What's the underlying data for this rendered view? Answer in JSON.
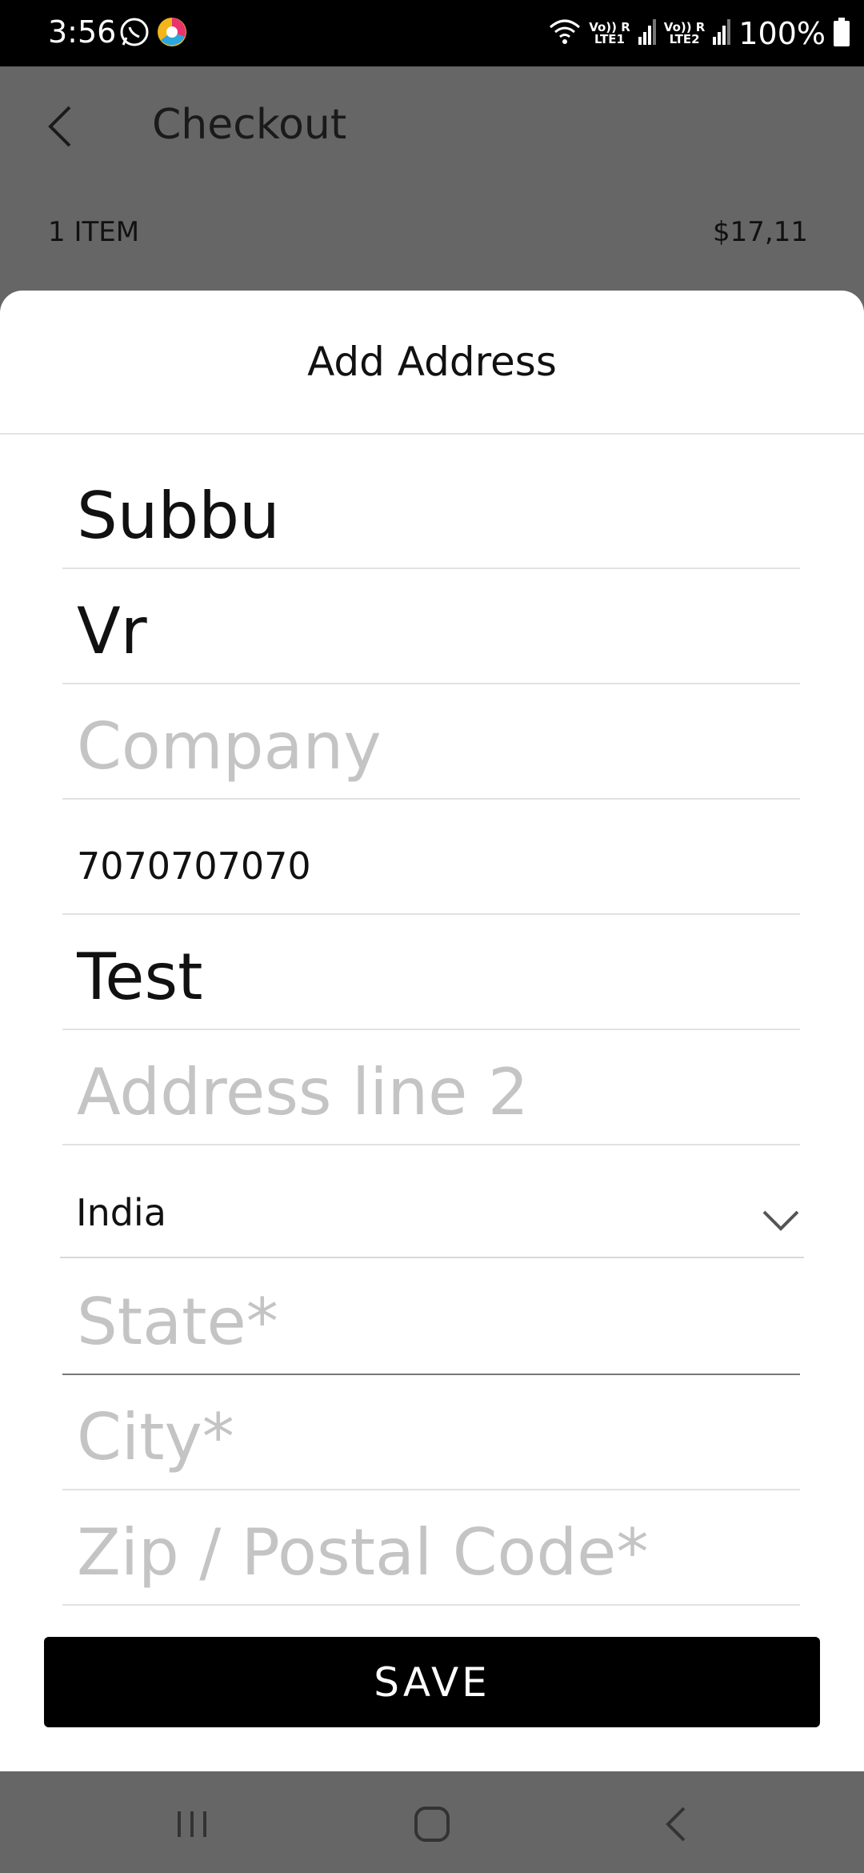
{
  "status_bar": {
    "time": "3:56",
    "lte1": "Vo)) R\nLTE1",
    "lte2": "Vo)) R\nLTE2",
    "battery": "100%",
    "icons": [
      "whatsapp-icon",
      "chrome-like-app-icon",
      "wifi-icon",
      "signal-icon",
      "battery-icon"
    ]
  },
  "header": {
    "title": "Checkout"
  },
  "summary": {
    "item_count": "1 ITEM",
    "total": "$17,11"
  },
  "sheet": {
    "title": "Add Address",
    "fields": {
      "first_name": {
        "value": "Subbu",
        "placeholder": ""
      },
      "last_name": {
        "value": "Vr",
        "placeholder": ""
      },
      "company": {
        "value": "",
        "placeholder": "Company"
      },
      "phone": {
        "value": "7070707070",
        "placeholder": ""
      },
      "address1": {
        "value": "Test",
        "placeholder": ""
      },
      "address2": {
        "value": "",
        "placeholder": "Address line 2"
      },
      "country": {
        "value": "India"
      },
      "state": {
        "value": "",
        "placeholder": "State*"
      },
      "city": {
        "value": "",
        "placeholder": "City*"
      },
      "zip": {
        "value": "",
        "placeholder": "Zip / Postal Code*"
      }
    },
    "save_label": "SAVE"
  },
  "colors": {
    "overlay": "#666666",
    "sheet": "#ffffff",
    "primary_button": "#000000",
    "placeholder": "#c4c4c4"
  }
}
